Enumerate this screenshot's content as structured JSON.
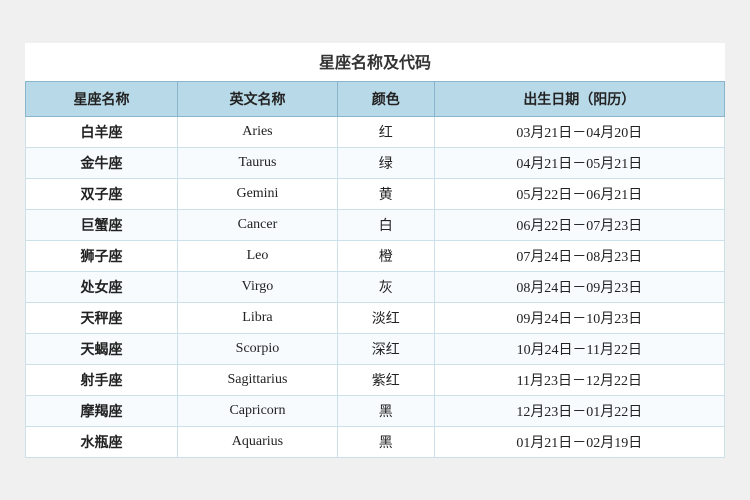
{
  "title": "星座名称及代码",
  "headers": [
    "星座名称",
    "英文名称",
    "颜色",
    "出生日期（阳历）"
  ],
  "rows": [
    {
      "chinese": "白羊座",
      "english": "Aries",
      "color": "红",
      "dates": "03月21日－04月20日"
    },
    {
      "chinese": "金牛座",
      "english": "Taurus",
      "color": "绿",
      "dates": "04月21日－05月21日"
    },
    {
      "chinese": "双子座",
      "english": "Gemini",
      "color": "黄",
      "dates": "05月22日－06月21日"
    },
    {
      "chinese": "巨蟹座",
      "english": "Cancer",
      "color": "白",
      "dates": "06月22日－07月23日"
    },
    {
      "chinese": "狮子座",
      "english": "Leo",
      "color": "橙",
      "dates": "07月24日－08月23日"
    },
    {
      "chinese": "处女座",
      "english": "Virgo",
      "color": "灰",
      "dates": "08月24日－09月23日"
    },
    {
      "chinese": "天秤座",
      "english": "Libra",
      "color": "淡红",
      "dates": "09月24日－10月23日"
    },
    {
      "chinese": "天蝎座",
      "english": "Scorpio",
      "color": "深红",
      "dates": "10月24日－11月22日"
    },
    {
      "chinese": "射手座",
      "english": "Sagittarius",
      "color": "紫红",
      "dates": "11月23日－12月22日"
    },
    {
      "chinese": "摩羯座",
      "english": "Capricorn",
      "color": "黑",
      "dates": "12月23日－01月22日"
    },
    {
      "chinese": "水瓶座",
      "english": "Aquarius",
      "color": "黑",
      "dates": "01月21日－02月19日"
    }
  ]
}
